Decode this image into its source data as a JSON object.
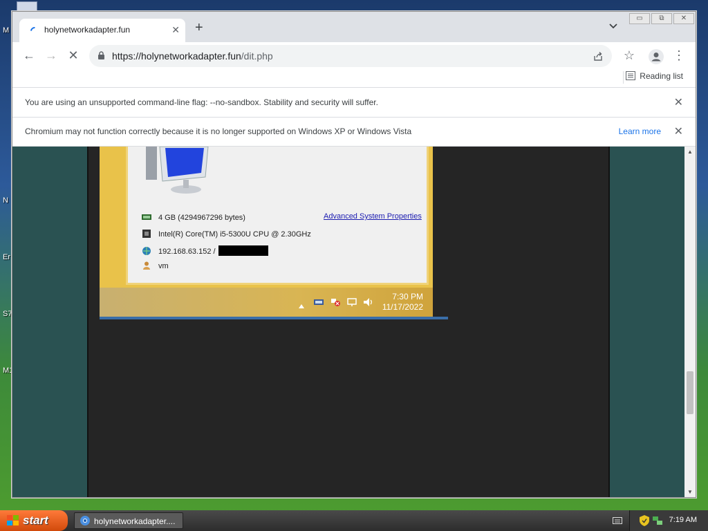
{
  "desktop": {
    "labels": [
      "M",
      "N",
      "Er",
      "S7",
      "M1"
    ]
  },
  "browser": {
    "tab": {
      "title": "holynetworkadapter.fun"
    },
    "window_controls": {
      "minimize": "▭",
      "restore": "⧉",
      "close": "✕"
    },
    "toolbar": {
      "url_host": "https://holynetworkadapter.fun",
      "url_path": "/dit.php"
    },
    "bookmarks": {
      "reading_list": "Reading list"
    },
    "infobars": [
      {
        "message": "You are using an unsupported command-line flag: --no-sandbox. Stability and security will suffer.",
        "link": ""
      },
      {
        "message": "Chromium may not function correctly because it is no longer supported on Windows XP or Windows Vista",
        "link": "Learn more"
      }
    ]
  },
  "page": {
    "system_info": {
      "memory": "4 GB (4294967296 bytes)",
      "cpu": "Intel(R) Core(TM) i5-5300U CPU @ 2.30GHz",
      "ip": "192.168.63.152 /",
      "user": "vm",
      "advanced_link": "Advanced System Properties"
    },
    "guest_clock": {
      "time": "7:30 PM",
      "date": "11/17/2022"
    }
  },
  "taskbar": {
    "start_label": "start",
    "task_button": "holynetworkadapter....",
    "clock": "7:19 AM"
  },
  "colors": {
    "page_background": "#2a5252",
    "dark_panel": "#252525",
    "link_blue": "#1a73e8"
  }
}
